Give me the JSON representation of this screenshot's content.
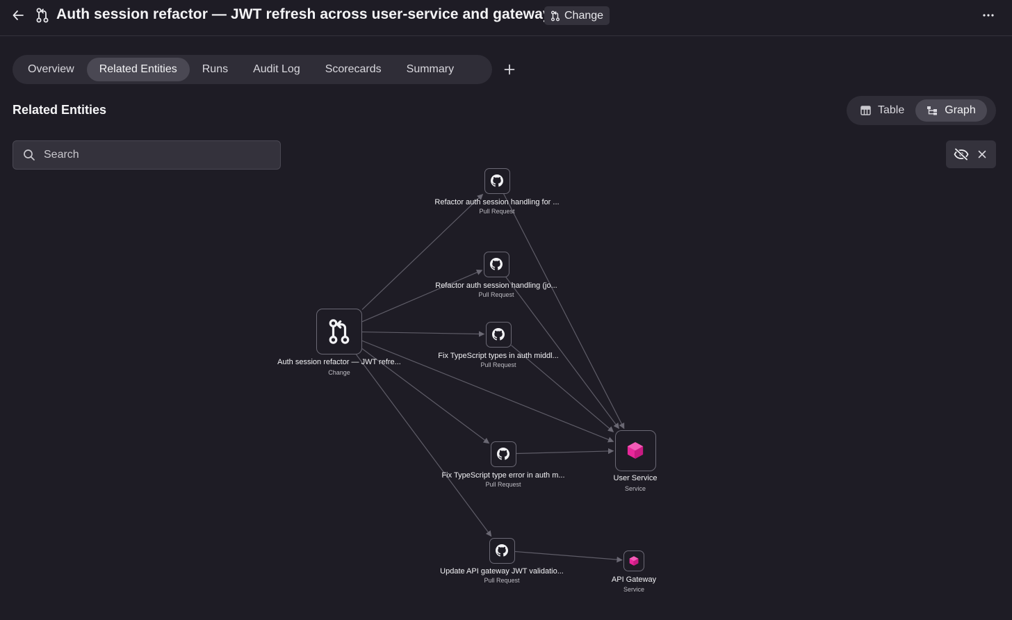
{
  "header": {
    "title": "Auth session refactor — JWT refresh across user-service and gateway",
    "type_badge": "Change"
  },
  "tabs": [
    {
      "label": "Overview",
      "active": false
    },
    {
      "label": "Related Entities",
      "active": true
    },
    {
      "label": "Runs",
      "active": false
    },
    {
      "label": "Audit Log",
      "active": false
    },
    {
      "label": "Scorecards",
      "active": false
    },
    {
      "label": "Summary",
      "active": false
    }
  ],
  "section": {
    "title": "Related Entities"
  },
  "view_toggle": {
    "table": "Table",
    "graph": "Graph",
    "selected": "Graph"
  },
  "search": {
    "placeholder": "Search",
    "value": ""
  },
  "colors": {
    "background": "#1e1c25",
    "service_accent": "#e8279a",
    "edge": "#5f5d68"
  },
  "graph": {
    "nodes": [
      {
        "id": "change",
        "label": "Auth session refactor — JWT refre...",
        "type": "Change",
        "icon": "git-pull-request-icon"
      },
      {
        "id": "pr1",
        "label": "Refactor auth session handling for ...",
        "type": "Pull Request",
        "icon": "github-icon"
      },
      {
        "id": "pr2",
        "label": "Refactor auth session handling (jo...",
        "type": "Pull Request",
        "icon": "github-icon"
      },
      {
        "id": "pr3",
        "label": "Fix TypeScript types in auth middl...",
        "type": "Pull Request",
        "icon": "github-icon"
      },
      {
        "id": "pr4",
        "label": "Fix TypeScript type error in auth m...",
        "type": "Pull Request",
        "icon": "github-icon"
      },
      {
        "id": "pr5",
        "label": "Update API gateway JWT validatio...",
        "type": "Pull Request",
        "icon": "github-icon"
      },
      {
        "id": "svc_user",
        "label": "User Service",
        "type": "Service",
        "icon": "cube-icon"
      },
      {
        "id": "svc_gw",
        "label": "API Gateway",
        "type": "Service",
        "icon": "cube-icon"
      }
    ],
    "edges": [
      {
        "from": "change",
        "to": "pr1"
      },
      {
        "from": "change",
        "to": "pr2"
      },
      {
        "from": "change",
        "to": "pr3"
      },
      {
        "from": "change",
        "to": "pr4"
      },
      {
        "from": "change",
        "to": "pr5"
      },
      {
        "from": "change",
        "to": "svc_user"
      },
      {
        "from": "pr1",
        "to": "svc_user"
      },
      {
        "from": "pr2",
        "to": "svc_user"
      },
      {
        "from": "pr3",
        "to": "svc_user"
      },
      {
        "from": "pr4",
        "to": "svc_user"
      },
      {
        "from": "pr5",
        "to": "svc_gw"
      }
    ]
  }
}
